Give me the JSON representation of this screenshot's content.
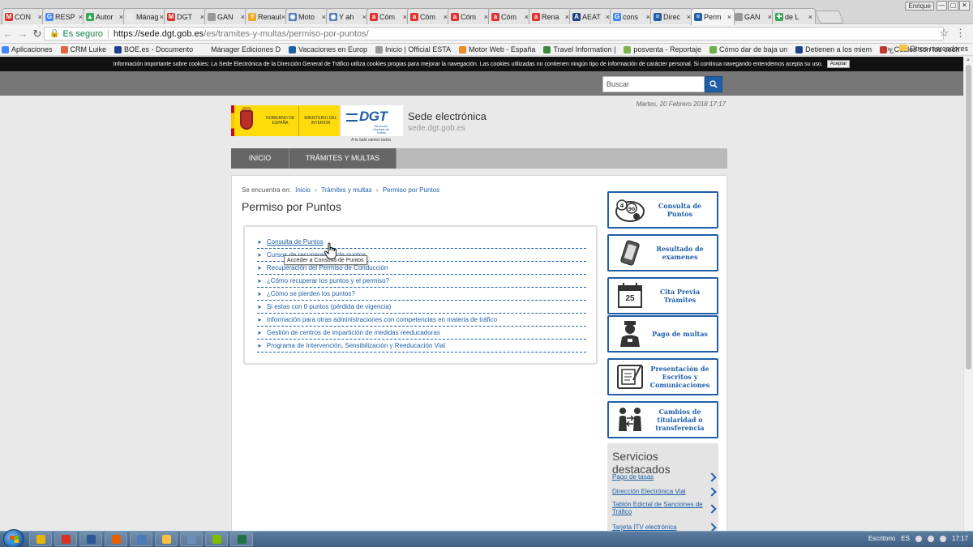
{
  "browser": {
    "tabs": [
      {
        "label": "CON",
        "color": "#d93025",
        "glyph": "M"
      },
      {
        "label": "RESP",
        "color": "#4285f4",
        "glyph": "G"
      },
      {
        "label": "Autor",
        "color": "#34a853",
        "glyph": "▲"
      },
      {
        "label": "Mánag",
        "color": "#e9e9e9",
        "glyph": ""
      },
      {
        "label": "DGT",
        "color": "#d93025",
        "glyph": "M"
      },
      {
        "label": "GAN",
        "color": "#999999",
        "glyph": ""
      },
      {
        "label": "Renault",
        "color": "#f5a623",
        "glyph": "Y"
      },
      {
        "label": "Moto",
        "color": "#4a7ab7",
        "glyph": "◉"
      },
      {
        "label": "Y ah",
        "color": "#4a7ab7",
        "glyph": "◉"
      },
      {
        "label": "Cóm",
        "color": "#e03030",
        "glyph": "a"
      },
      {
        "label": "Cóm",
        "color": "#e03030",
        "glyph": "a"
      },
      {
        "label": "Cóm",
        "color": "#e03030",
        "glyph": "a"
      },
      {
        "label": "Cóm",
        "color": "#e03030",
        "glyph": "a"
      },
      {
        "label": "Rena",
        "color": "#e03030",
        "glyph": "a"
      },
      {
        "label": "AEAT",
        "color": "#1f3f86",
        "glyph": "A"
      },
      {
        "label": "cons",
        "color": "#4285f4",
        "glyph": "G"
      },
      {
        "label": "Direc",
        "color": "#1f5fa8",
        "glyph": "="
      },
      {
        "label": "Perm",
        "color": "#1f5fa8",
        "glyph": "=",
        "active": true
      },
      {
        "label": "GAN",
        "color": "#999999",
        "glyph": ""
      },
      {
        "label": "de L",
        "color": "#34a853",
        "glyph": "✚"
      }
    ],
    "user_badge": "Enrique",
    "window_buttons": [
      "—",
      "▢",
      "✕"
    ],
    "secure_label": "Es seguro",
    "url_host": "https://sede.dgt.gob.es",
    "url_path": "/es/tramites-y-multas/permiso-por-puntos/",
    "bookmarks": [
      {
        "label": "Aplicaciones",
        "color": "#4285f4"
      },
      {
        "label": "CRM Luike",
        "color": "#e0643c"
      },
      {
        "label": "BOE.es - Documento",
        "color": "#1f3f86"
      },
      {
        "label": "Mánager Ediciones D",
        "color": "#f2f2f2"
      },
      {
        "label": "Vacaciones en Europ",
        "color": "#1f5fa8"
      },
      {
        "label": "Inicio | Official ESTA",
        "color": "#999999"
      },
      {
        "label": "Motor Web - España",
        "color": "#f08a24"
      },
      {
        "label": "Travel Information | ",
        "color": "#3a8a3a"
      },
      {
        "label": "posventa - Reportaje",
        "color": "#7fb24a"
      },
      {
        "label": "Cómo dar de baja un",
        "color": "#6ab04c"
      },
      {
        "label": "Detienen a los miem",
        "color": "#1f3f86"
      },
      {
        "label": "¿Cuáles son los coch",
        "color": "#c0392b"
      }
    ],
    "bookmarks_more": "»",
    "other_bookmarks": "Otros marcadores"
  },
  "cookie_banner": {
    "text": "Información importante sobre cookies: La Sede Electrónica de la Dirección General de Tráfico utiliza cookies propias para mejorar la navegación. Las cookies utilizadas no contienen ningún tipo de información de carácter personal. Si continua navegando entendemos acepta su uso.",
    "accept": "Aceptar"
  },
  "header": {
    "search_placeholder": "Buscar",
    "date": "Martes, 20 Febrero 2018 17:17",
    "gob_text": "GOBIERNO DE ESPAÑA",
    "ministry_text": "MINISTERIO DEL INTERIOR",
    "dgt_logo": "DGT",
    "dgt_sub": "Dirección General de Tráfico",
    "slogan": "A tu lado vamos todos",
    "site_title": "Sede electrónica",
    "site_host": "sede.dgt.gob.es"
  },
  "nav": {
    "items": [
      "INICIO",
      "TRÁMITES Y MULTAS"
    ]
  },
  "content": {
    "breadcrumb_prefix": "Se encuentra en:",
    "breadcrumb": [
      "Inicio",
      "Trámites y multas",
      "Permiso por Puntos"
    ],
    "title": "Permiso por Puntos",
    "links": [
      "Consulta de Puntos",
      "Cursos de recuperación de puntos",
      "Recuperación del Permiso de Conducción",
      "¿Cómo recuperar los puntos y el permiso?",
      "¿Cómo se pierden los puntos?",
      "Si estas con 0 puntos (pérdida de vigencia)",
      "Información para otras administraciones con competencias en materia de tráfico",
      "Gestión de centros de impartición de medidas reeducadoras",
      "Programa de Intervención, Sensibilización y Reeducación Vial"
    ],
    "tooltip": "Acceder a Consulta de Puntos"
  },
  "services": [
    {
      "label": "Consulta de Puntos",
      "icon": "points-badge-icon"
    },
    {
      "label": "Resultado de examenes",
      "icon": "phone-icon"
    },
    {
      "label": "Cita Previa Trámites",
      "icon": "calendar-icon",
      "day": "25"
    },
    {
      "label": "Pago de multas",
      "icon": "officer-icon"
    },
    {
      "label": "Presentación de Escritos y Comunicaciones",
      "icon": "document-pen-icon"
    },
    {
      "label": "Cambios de titularidad o transferencia",
      "icon": "people-exchange-icon"
    }
  ],
  "featured": {
    "title": "Servicios destacados",
    "items": [
      "Pago de tasas",
      "Dirección Electrónica Vial",
      "Tablón Edictal de Sanciones de Tráfico",
      "Tarjeta ITV electrónica"
    ]
  },
  "taskbar": {
    "apps": [
      {
        "name": "chrome",
        "color": "#e8b30a"
      },
      {
        "name": "files",
        "color": "#d93025"
      },
      {
        "name": "word",
        "color": "#2b5797"
      },
      {
        "name": "firefox",
        "color": "#e66000"
      },
      {
        "name": "window",
        "color": "#4a7ab7"
      },
      {
        "name": "folder",
        "color": "#f5c242"
      },
      {
        "name": "screen",
        "color": "#6d8fb5"
      },
      {
        "name": "paint",
        "color": "#7fba00"
      },
      {
        "name": "excel",
        "color": "#217346"
      }
    ],
    "desktop_label": "Escritorio",
    "language": "ES",
    "time": "17:17"
  },
  "colors": {
    "accent": "#1f5fa8",
    "gray_bar": "#777777",
    "nav_bg": "#666666"
  }
}
